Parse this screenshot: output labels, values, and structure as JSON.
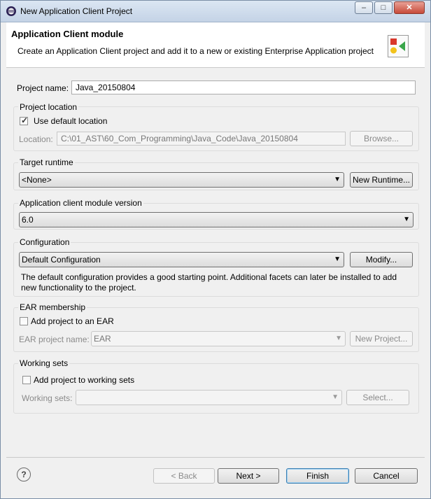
{
  "window": {
    "title": "New Application Client Project",
    "controls": {
      "minimize": "‒",
      "maximize": "□",
      "close": "✕"
    }
  },
  "header": {
    "title": "Application Client module",
    "description": "Create an Application Client project and add it to a new or existing Enterprise Application project",
    "icon": "app-client-wizard-icon"
  },
  "project_name": {
    "label": "Project name:",
    "value": "Java_20150804"
  },
  "project_location": {
    "group_label": "Project location",
    "use_default_label": "Use default location",
    "use_default_checked": true,
    "location_label": "Location:",
    "location_value": "C:\\01_AST\\60_Com_Programming\\Java_Code\\Java_20150804",
    "browse_label": "Browse..."
  },
  "target_runtime": {
    "group_label": "Target runtime",
    "selected": "<None>",
    "new_runtime_label": "New Runtime..."
  },
  "module_version": {
    "group_label": "Application client module version",
    "selected": "6.0"
  },
  "configuration": {
    "group_label": "Configuration",
    "selected": "Default Configuration",
    "modify_label": "Modify...",
    "description": "The default configuration provides a good starting point. Additional facets can later be installed to add new functionality to the project."
  },
  "ear_membership": {
    "group_label": "EAR membership",
    "add_label": "Add project to an EAR",
    "add_checked": false,
    "ear_name_label": "EAR project name:",
    "ear_name_value": "EAR",
    "new_project_label": "New Project..."
  },
  "working_sets": {
    "group_label": "Working sets",
    "add_label": "Add project to working sets",
    "add_checked": false,
    "sets_label": "Working sets:",
    "sets_value": "",
    "select_label": "Select..."
  },
  "footer": {
    "help": "?",
    "back_label": "< Back",
    "next_label": "Next >",
    "finish_label": "Finish",
    "cancel_label": "Cancel"
  },
  "colors": {
    "default_button_border": "#3c7fb1",
    "titlebar": "#c4d3e6",
    "close_button": "#c74a39"
  }
}
